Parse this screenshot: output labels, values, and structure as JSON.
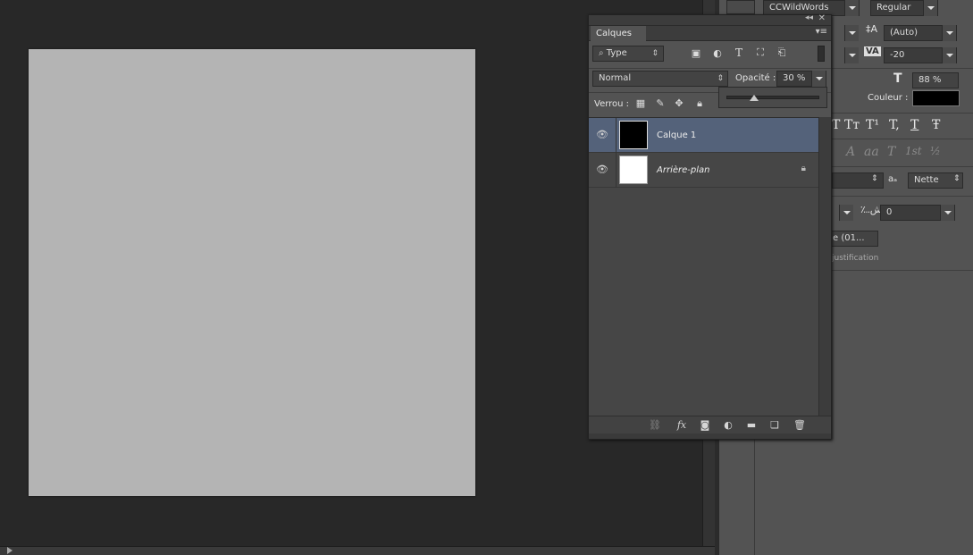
{
  "char_panel": {
    "font_family": "CCWildWords",
    "font_style": "Regular",
    "leading": "(Auto)",
    "tracking": "-20",
    "vertical_scale": "88 %",
    "color_label": "Couleur :",
    "color_value": "#000000",
    "style_row1": [
      "T",
      "Tт",
      "T¹",
      "T,",
      "T",
      "Ŧ"
    ],
    "style_row2": [
      "A",
      "aa",
      "T",
      "1st",
      "½"
    ],
    "antialias": "Nette",
    "kashida_value": "0",
    "language_partial": "e (01...",
    "justification_label": "justification"
  },
  "layers_panel": {
    "tab_label": "Calques",
    "filter_type": "Type",
    "blend_mode": "Normal",
    "opacity_label": "Opacité :",
    "opacity_value": "30 %",
    "opacity_fraction": 0.3,
    "lock_label": "Verrou :",
    "layers": [
      {
        "name": "Calque 1",
        "selected": true,
        "thumb_color": "#000000",
        "locked": false
      },
      {
        "name": "Arrière-plan",
        "selected": false,
        "thumb_color": "#ffffff",
        "locked": true
      }
    ]
  },
  "colors": {
    "canvas": "#b4b4b4",
    "workspace": "#282828",
    "panel": "#535353",
    "selected_layer": "#54627a"
  }
}
